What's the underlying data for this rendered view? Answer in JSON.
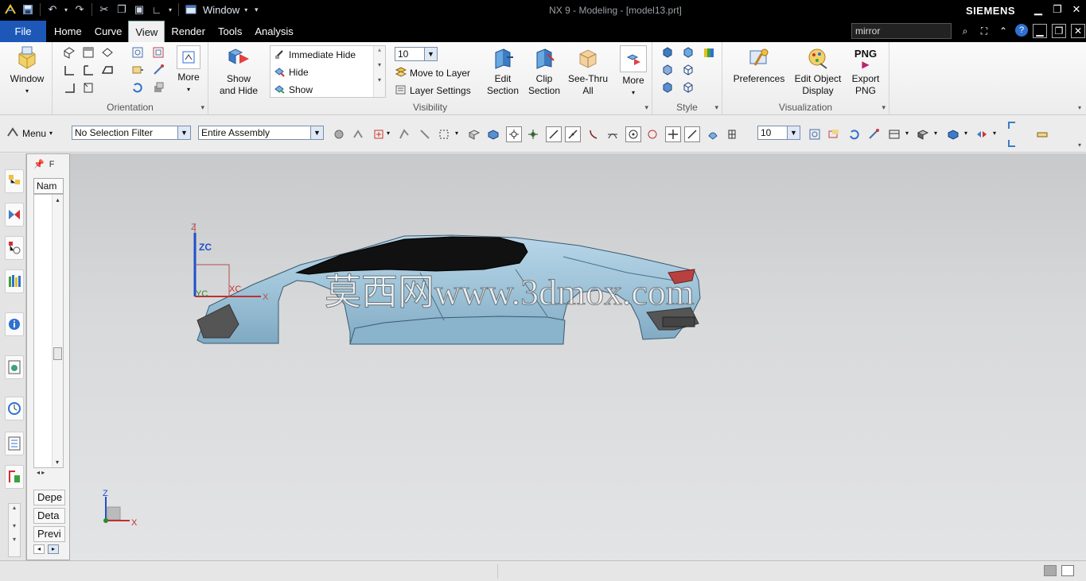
{
  "titlebar": {
    "window_menu": "Window",
    "title": "NX 9 - Modeling - [model13.prt]",
    "brand": "SIEMENS"
  },
  "tabs": {
    "file": "File",
    "items": [
      "Home",
      "Curve",
      "View",
      "Render",
      "Tools",
      "Analysis"
    ],
    "active": "View"
  },
  "search": {
    "value": "mirror"
  },
  "ribbon": {
    "window_btn": "Window",
    "orientation": {
      "label": "Orientation",
      "more": "More"
    },
    "visibility": {
      "show_hide": "Show\nand Hide",
      "immediate_hide": "Immediate Hide",
      "hide": "Hide",
      "show": "Show",
      "layer_value": "10",
      "move_to_layer": "Move to Layer",
      "layer_settings": "Layer Settings",
      "edit_section": "Edit\nSection",
      "clip_section": "Clip\nSection",
      "see_thru_all": "See-Thru\nAll",
      "more": "More",
      "label": "Visibility"
    },
    "style": {
      "label": "Style"
    },
    "visualization": {
      "preferences": "Preferences",
      "edit_object_display": "Edit Object\nDisplay",
      "png": "PNG",
      "export_png": "Export\nPNG",
      "label": "Visualization"
    }
  },
  "toolbar2": {
    "menu": "Menu",
    "selection_filter": "No Selection Filter",
    "scope": "Entire Assembly",
    "layer_value": "10"
  },
  "navigator": {
    "col_name": "Nam",
    "sections": [
      "Depe",
      "Deta",
      "Previ"
    ]
  },
  "graphics": {
    "watermark": "莫西网www.3dmox.com",
    "wcs": {
      "z": "Z",
      "zc": "ZC",
      "yc": "YC",
      "xc": "XC",
      "x": "X"
    },
    "triad": {
      "z": "Z",
      "x": "X"
    }
  },
  "colors": {
    "titlebar_bg": "#000000",
    "file_tab": "#1d58b8",
    "car_body": "#9ec3d8",
    "car_glass": "#111111",
    "taillight": "#b8413f"
  }
}
